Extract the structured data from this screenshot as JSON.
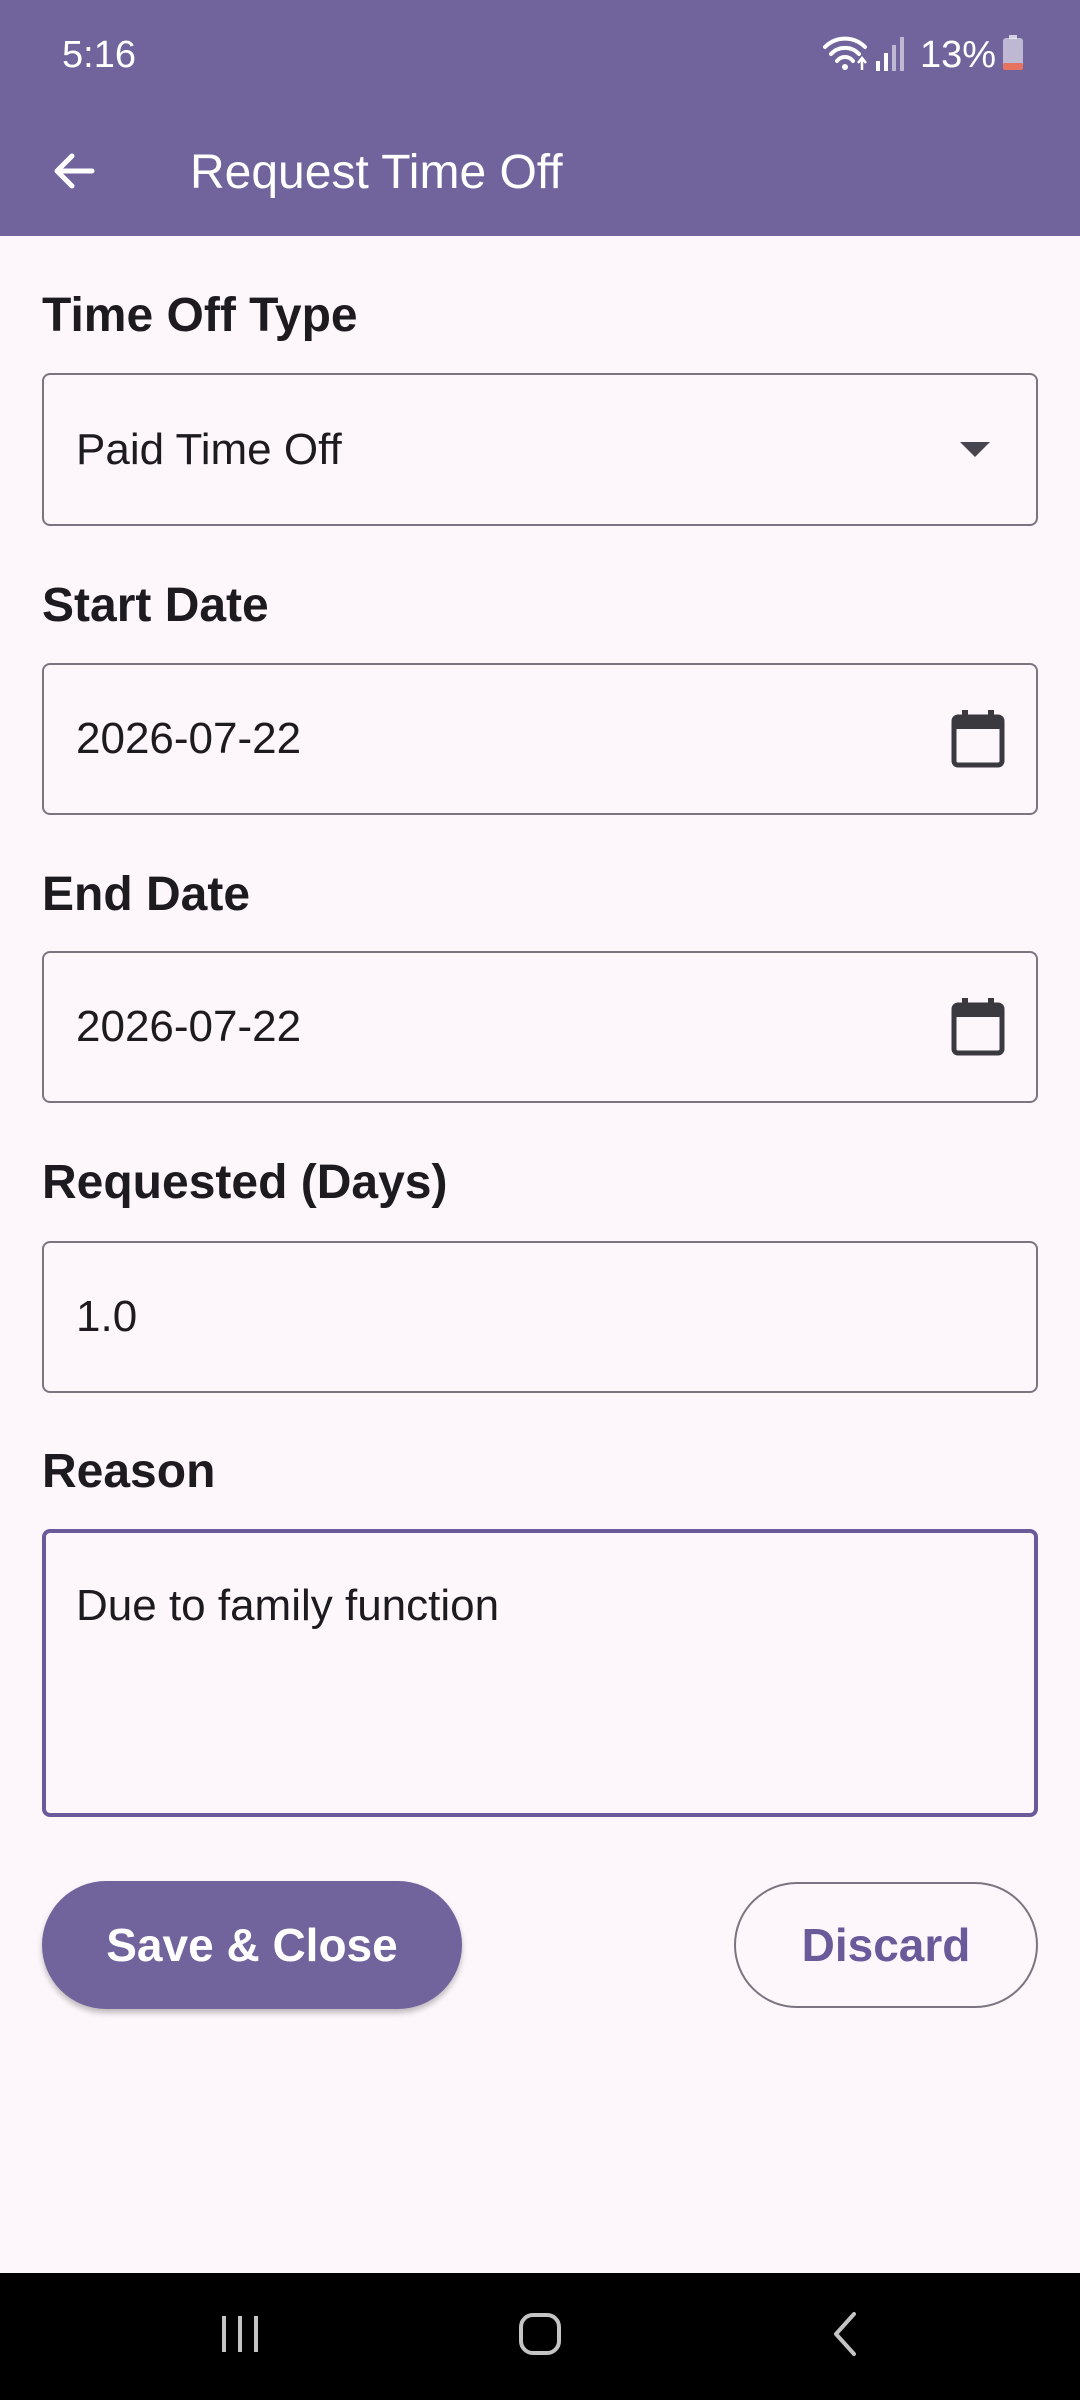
{
  "status_bar": {
    "time": "5:16",
    "battery": "13%"
  },
  "app_bar": {
    "title": "Request Time Off",
    "icons": {
      "back": "arrow-back-icon"
    }
  },
  "form": {
    "time_off_type": {
      "label": "Time Off Type",
      "value": "Paid Time Off",
      "icon": "dropdown-arrow-icon"
    },
    "start_date": {
      "label": "Start Date",
      "value": "2026-07-22",
      "icon": "calendar-icon"
    },
    "end_date": {
      "label": "End Date",
      "value": "2026-07-22",
      "icon": "calendar-icon"
    },
    "requested_days": {
      "label": "Requested (Days)",
      "value": "1.0"
    },
    "reason": {
      "label": "Reason",
      "value": "Due to family function"
    }
  },
  "actions": {
    "save_label": "Save & Close",
    "discard_label": "Discard"
  },
  "colors": {
    "primary": "#71639c",
    "background": "#fdf7fc",
    "outline": "#7a757f",
    "focused_outline": "#6a5a9a",
    "battery_low": "#e5735f"
  }
}
